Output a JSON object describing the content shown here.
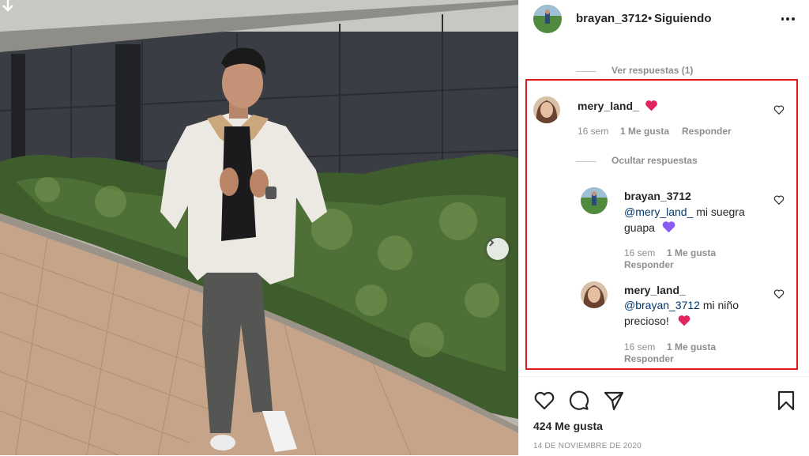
{
  "post": {
    "username": "brayan_3712",
    "separator": "•",
    "follow_status": "Siguiendo"
  },
  "replies_toggle_top": "Ver respuestas (1)",
  "comment": {
    "username": "mery_land_",
    "time": "16 sem",
    "likes": "1 Me gusta",
    "reply": "Responder",
    "hide_replies": "Ocultar respuestas"
  },
  "replies": [
    {
      "username": "brayan_3712",
      "mention": "@mery_land_",
      "text_line1": " mi suegra",
      "text_line2": "guapa",
      "time": "16 sem",
      "likes": "1 Me gusta",
      "reply": "Responder"
    },
    {
      "username": "mery_land_",
      "mention": "@brayan_3712",
      "text_line1": " mi niño",
      "text_line2": "precioso!",
      "time": "16 sem",
      "likes": "1 Me gusta",
      "reply": "Responder"
    }
  ],
  "footer": {
    "likes": "424 Me gusta",
    "date": "14 DE NOVIEMBRE DE 2020"
  },
  "colors": {
    "highlight_box": "#e01b1b",
    "mention": "#00376b",
    "red_heart_emoji": "#e0245e",
    "purple_heart_emoji": "#8a5cf5"
  },
  "icons": [
    "more-icon",
    "heart-icon",
    "comment-icon",
    "share-icon",
    "bookmark-icon",
    "next-arrow-icon",
    "download-arrow-icon"
  ]
}
